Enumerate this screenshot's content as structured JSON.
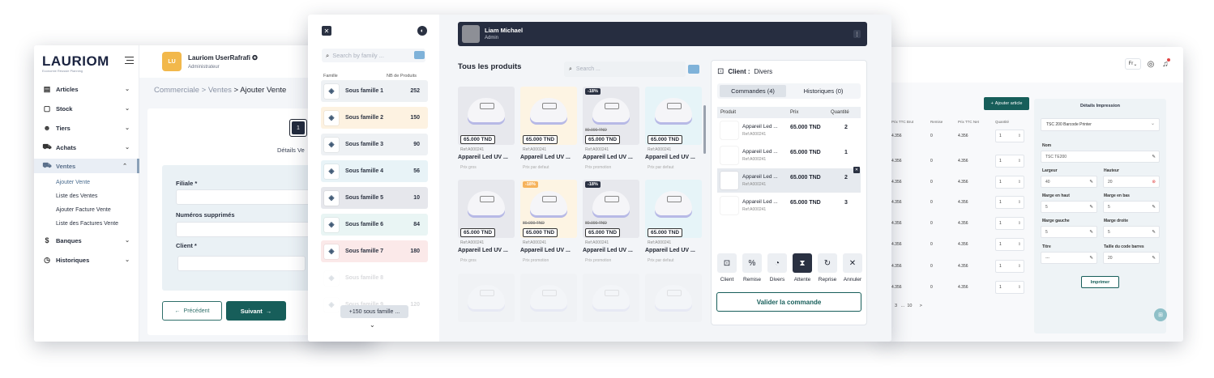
{
  "left_window": {
    "logo": "LAURIOM",
    "logo_tagline": "Economie Réussie Planning",
    "user": {
      "initials": "LU",
      "name": "Lauriom UserRafrafi",
      "role": "Administrateur"
    },
    "nav": [
      {
        "label": "Articles"
      },
      {
        "label": "Stock"
      },
      {
        "label": "Tiers"
      },
      {
        "label": "Achats"
      },
      {
        "label": "Ventes"
      },
      {
        "label": "Banques"
      },
      {
        "label": "Historiques"
      }
    ],
    "sub_nav": [
      "Ajouter Vente",
      "Liste des Ventes",
      "Ajouter Facture Vente",
      "Liste des Factures Vente"
    ],
    "breadcrumb": {
      "root": "Commerciale",
      "mid": "Ventes",
      "current": "Ajouter Vente",
      "sep": ">"
    },
    "step_number": "1",
    "step_label": "Détails Ve",
    "fields": [
      "Filiale *",
      "Numéros supprimés",
      "Client *"
    ],
    "prev_label": "Précédent",
    "next_label": "Suivant"
  },
  "center_window": {
    "family_search_placeholder": "Search by family ...",
    "family_headers": {
      "name": "Famille",
      "count": "NB de Produits"
    },
    "families": [
      {
        "name": "Sous famille 1",
        "count": "252",
        "color": "#eef1f4"
      },
      {
        "name": "Sous famille 2",
        "count": "150",
        "color": "#fdf2e1"
      },
      {
        "name": "Sous famille 3",
        "count": "90",
        "color": "#eef1f4"
      },
      {
        "name": "Sous famille 4",
        "count": "56",
        "color": "#e8f3f7"
      },
      {
        "name": "Sous famille 5",
        "count": "10",
        "color": "#e6e7ec"
      },
      {
        "name": "Sous famille 6",
        "count": "84",
        "color": "#e9f5f4"
      },
      {
        "name": "Sous famille 7",
        "count": "180",
        "color": "#fbe9e9"
      },
      {
        "name": "Sous famille 8",
        "count": ""
      },
      {
        "name": "Sous famille 9",
        "count": "120"
      }
    ],
    "family_more": "+150 sous famille ...",
    "profile": {
      "name": "Liam Michael",
      "role": "Admin"
    },
    "products_title": "Tous les produits",
    "product_search_placeholder": "Search ...",
    "products": [
      {
        "price": "65.000 TND",
        "old_price": "",
        "discount": "",
        "ref": "Ref:A000241",
        "name": "Appareil Led UV ...",
        "note": "Prix gros",
        "bg": "#e7e8ed"
      },
      {
        "price": "65.000 TND",
        "old_price": "",
        "discount": "",
        "ref": "Ref:A000241",
        "name": "Appareil Led UV ...",
        "note": "Prix par defaut",
        "bg": "#fdf4e3"
      },
      {
        "price": "65.000 TND",
        "old_price": "80.000 TND",
        "discount": "-18%",
        "ref": "Ref:A000241",
        "name": "Appareil Led UV ...",
        "note": "Prix promotion",
        "bg": "#e7e8ed"
      },
      {
        "price": "65.000 TND",
        "old_price": "",
        "discount": "",
        "ref": "Ref:A000241",
        "name": "Appareil Led UV ...",
        "note": "Prix par defaut",
        "bg": "#e6f4f8"
      },
      {
        "price": "65.000 TND",
        "old_price": "",
        "discount": "",
        "ref": "Ref:A000241",
        "name": "Appareil Led UV ...",
        "note": "Prix gros",
        "bg": "#e7e8ed"
      },
      {
        "price": "65.000 TND",
        "old_price": "80.000 TND",
        "discount": "-18%",
        "ref": "Ref:A000241",
        "name": "Appareil Led UV ...",
        "note": "Prix promotion",
        "bg": "#fdf4e3"
      },
      {
        "price": "65.000 TND",
        "old_price": "80.000 TND",
        "discount": "-18%",
        "ref": "Ref:A000241",
        "name": "Appareil Led UV ...",
        "note": "Prix promotion",
        "bg": "#e7e8ed"
      },
      {
        "price": "65.000 TND",
        "old_price": "",
        "discount": "",
        "ref": "Ref:A000241",
        "name": "Appareil Led UV ...",
        "note": "Prix par defaut",
        "bg": "#e6f4f8"
      }
    ],
    "client": {
      "label": "Client :",
      "value": "Divers"
    },
    "tabs": [
      "Commandes (4)",
      "Historiques (0)"
    ],
    "order_headers": {
      "product": "Produit",
      "price": "Prix",
      "qty": "Quantité"
    },
    "orders": [
      {
        "name": "Appareil Led ...",
        "ref": "Ref:A000241",
        "price": "65.000 TND",
        "qty": "2"
      },
      {
        "name": "Appareil Led ...",
        "ref": "Ref:A000241",
        "price": "65.000 TND",
        "qty": "1"
      },
      {
        "name": "Appareil Led ...",
        "ref": "Ref:A000241",
        "price": "65.000 TND",
        "qty": "2"
      },
      {
        "name": "Appareil Led ...",
        "ref": "Ref:A000241",
        "price": "65.000 TND",
        "qty": "3"
      }
    ],
    "actions": [
      {
        "label": "Client",
        "glyph": "⊡"
      },
      {
        "label": "Remise",
        "glyph": "%"
      },
      {
        "label": "Divers",
        "glyph": "◔"
      },
      {
        "label": "Attente",
        "glyph": "⧗"
      },
      {
        "label": "Reprise",
        "glyph": "↻"
      },
      {
        "label": "Annuler",
        "glyph": "✕"
      }
    ],
    "validate_label": "Valider la commande"
  },
  "right_window": {
    "lang": "Fr",
    "add_article": "Ajouter article",
    "table_headers": [
      "Prix TTC Brut",
      "Remise",
      "Prix TTC Net",
      "Quantité"
    ],
    "rows": [
      {
        "brut": "4.356",
        "remise": "0",
        "net": "4.356",
        "qty": "1"
      },
      {
        "brut": "4.356",
        "remise": "0",
        "net": "4.356",
        "qty": "1"
      },
      {
        "brut": "4.356",
        "remise": "0",
        "net": "4.356",
        "qty": "1"
      },
      {
        "brut": "4.356",
        "remise": "0",
        "net": "4.356",
        "qty": "1"
      },
      {
        "brut": "4.356",
        "remise": "0",
        "net": "4.356",
        "qty": "1"
      },
      {
        "brut": "4.356",
        "remise": "0",
        "net": "4.356",
        "qty": "1"
      },
      {
        "brut": "4.356",
        "remise": "0",
        "net": "4.356",
        "qty": "1"
      },
      {
        "brut": "4.356",
        "remise": "0",
        "net": "4.356",
        "qty": "1"
      }
    ],
    "pager": [
      "3",
      "...",
      "10",
      ">"
    ],
    "print": {
      "title": "Détails Impression",
      "printer": "TSC 200 Barcode Printer",
      "nom_label": "Nom",
      "nom_value": "TSC TE200",
      "largeur_label": "Largeur",
      "largeur_value": "40",
      "hauteur_label": "Hauteur",
      "hauteur_value": "20",
      "marge_haut_label": "Marge en haut",
      "marge_haut_value": "5",
      "marge_bas_label": "Marge en bas",
      "marge_bas_value": "5",
      "marge_gauche_label": "Marge gauche",
      "marge_gauche_value": "5",
      "marge_droite_label": "Marge droite",
      "marge_droite_value": "5",
      "titre_label": "Titre",
      "titre_value": "---",
      "taille_label": "Taille du code barres",
      "taille_value": "20",
      "print_label": "Imprimer"
    }
  },
  "colors": {
    "accent": "#175e5a",
    "dark": "#262d40",
    "highlight": "#f2b84b"
  }
}
